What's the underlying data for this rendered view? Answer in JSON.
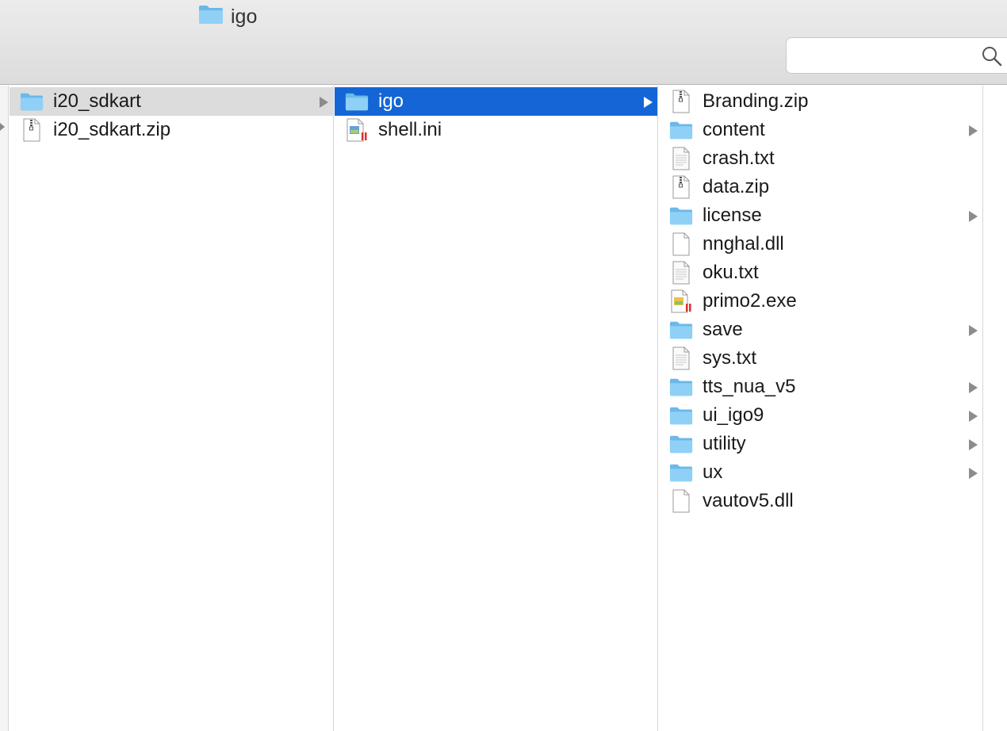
{
  "window": {
    "title": "igo",
    "title_icon": "folder-icon",
    "search": {
      "placeholder": "",
      "icon": "search-icon"
    }
  },
  "colors": {
    "folder": "#7cc6f4",
    "selection_active": "#1466d6",
    "selection_inactive": "#dcdcdc",
    "toolbar": "#e2e2e2"
  },
  "columns": [
    {
      "items": [
        {
          "name": "i20_sdkart",
          "kind": "folder",
          "icon": "folder-icon",
          "has_children": true,
          "selected": "inactive"
        },
        {
          "name": "i20_sdkart.zip",
          "kind": "zip",
          "icon": "zip-file-icon",
          "has_children": false,
          "selected": ""
        }
      ]
    },
    {
      "items": [
        {
          "name": "igo",
          "kind": "folder",
          "icon": "folder-icon",
          "has_children": true,
          "selected": "active"
        },
        {
          "name": "shell.ini",
          "kind": "ini",
          "icon": "ini-file-icon",
          "has_children": false,
          "selected": ""
        }
      ]
    },
    {
      "items": [
        {
          "name": "Branding.zip",
          "kind": "zip",
          "icon": "zip-file-icon",
          "has_children": false,
          "selected": ""
        },
        {
          "name": "content",
          "kind": "folder",
          "icon": "folder-icon",
          "has_children": true,
          "selected": ""
        },
        {
          "name": "crash.txt",
          "kind": "txt",
          "icon": "text-file-icon",
          "has_children": false,
          "selected": ""
        },
        {
          "name": "data.zip",
          "kind": "zip",
          "icon": "zip-file-icon",
          "has_children": false,
          "selected": ""
        },
        {
          "name": "license",
          "kind": "folder",
          "icon": "folder-icon",
          "has_children": true,
          "selected": ""
        },
        {
          "name": "nnghal.dll",
          "kind": "blank",
          "icon": "blank-file-icon",
          "has_children": false,
          "selected": ""
        },
        {
          "name": "oku.txt",
          "kind": "txt",
          "icon": "text-file-icon",
          "has_children": false,
          "selected": ""
        },
        {
          "name": "primo2.exe",
          "kind": "exe",
          "icon": "exe-file-icon",
          "has_children": false,
          "selected": ""
        },
        {
          "name": "save",
          "kind": "folder",
          "icon": "folder-icon",
          "has_children": true,
          "selected": ""
        },
        {
          "name": "sys.txt",
          "kind": "txt",
          "icon": "text-file-icon",
          "has_children": false,
          "selected": ""
        },
        {
          "name": "tts_nua_v5",
          "kind": "folder",
          "icon": "folder-icon",
          "has_children": true,
          "selected": ""
        },
        {
          "name": "ui_igo9",
          "kind": "folder",
          "icon": "folder-icon",
          "has_children": true,
          "selected": ""
        },
        {
          "name": "utility",
          "kind": "folder",
          "icon": "folder-icon",
          "has_children": true,
          "selected": ""
        },
        {
          "name": "ux",
          "kind": "folder",
          "icon": "folder-icon",
          "has_children": true,
          "selected": ""
        },
        {
          "name": "vautov5.dll",
          "kind": "blank",
          "icon": "blank-file-icon",
          "has_children": false,
          "selected": ""
        }
      ]
    }
  ]
}
